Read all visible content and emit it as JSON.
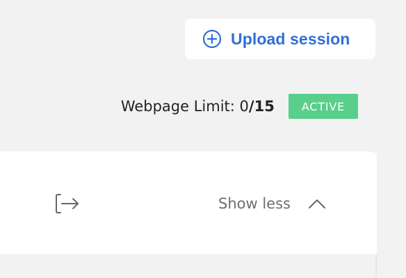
{
  "upload_button": {
    "label": "Upload session",
    "icon": "plus-circle-icon",
    "color": "#2f6fd6"
  },
  "limit": {
    "label_prefix": "Webpage Limit: ",
    "used": "0",
    "total": "/15"
  },
  "status_badge": {
    "label": "ACTIVE",
    "color": "#59cf8b"
  },
  "card": {
    "export_icon": "export-icon",
    "toggle_label": "Show less",
    "toggle_icon": "chevron-up-icon"
  }
}
